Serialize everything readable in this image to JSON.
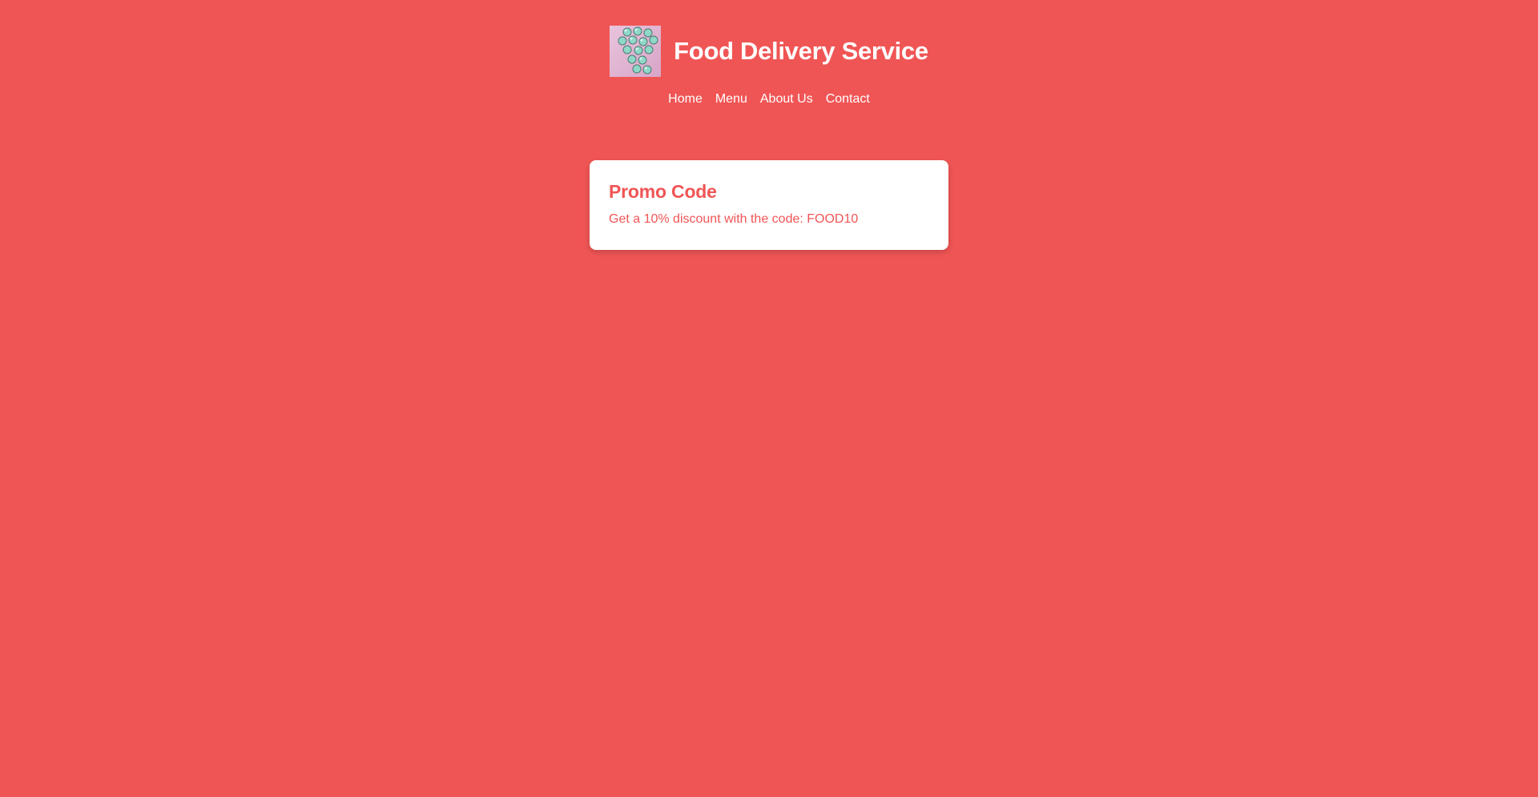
{
  "site": {
    "title": "Food Delivery Service",
    "logo_icon": "candy-image-icon",
    "colors": {
      "background": "#f05555",
      "card_background": "#ffffff",
      "text_on_background": "#ffffff",
      "card_text": "#f05555"
    }
  },
  "nav": {
    "items": [
      {
        "label": "Home"
      },
      {
        "label": "Menu"
      },
      {
        "label": "About Us"
      },
      {
        "label": "Contact"
      }
    ]
  },
  "promo": {
    "title": "Promo Code",
    "text": "Get a 10% discount with the code: FOOD10"
  }
}
